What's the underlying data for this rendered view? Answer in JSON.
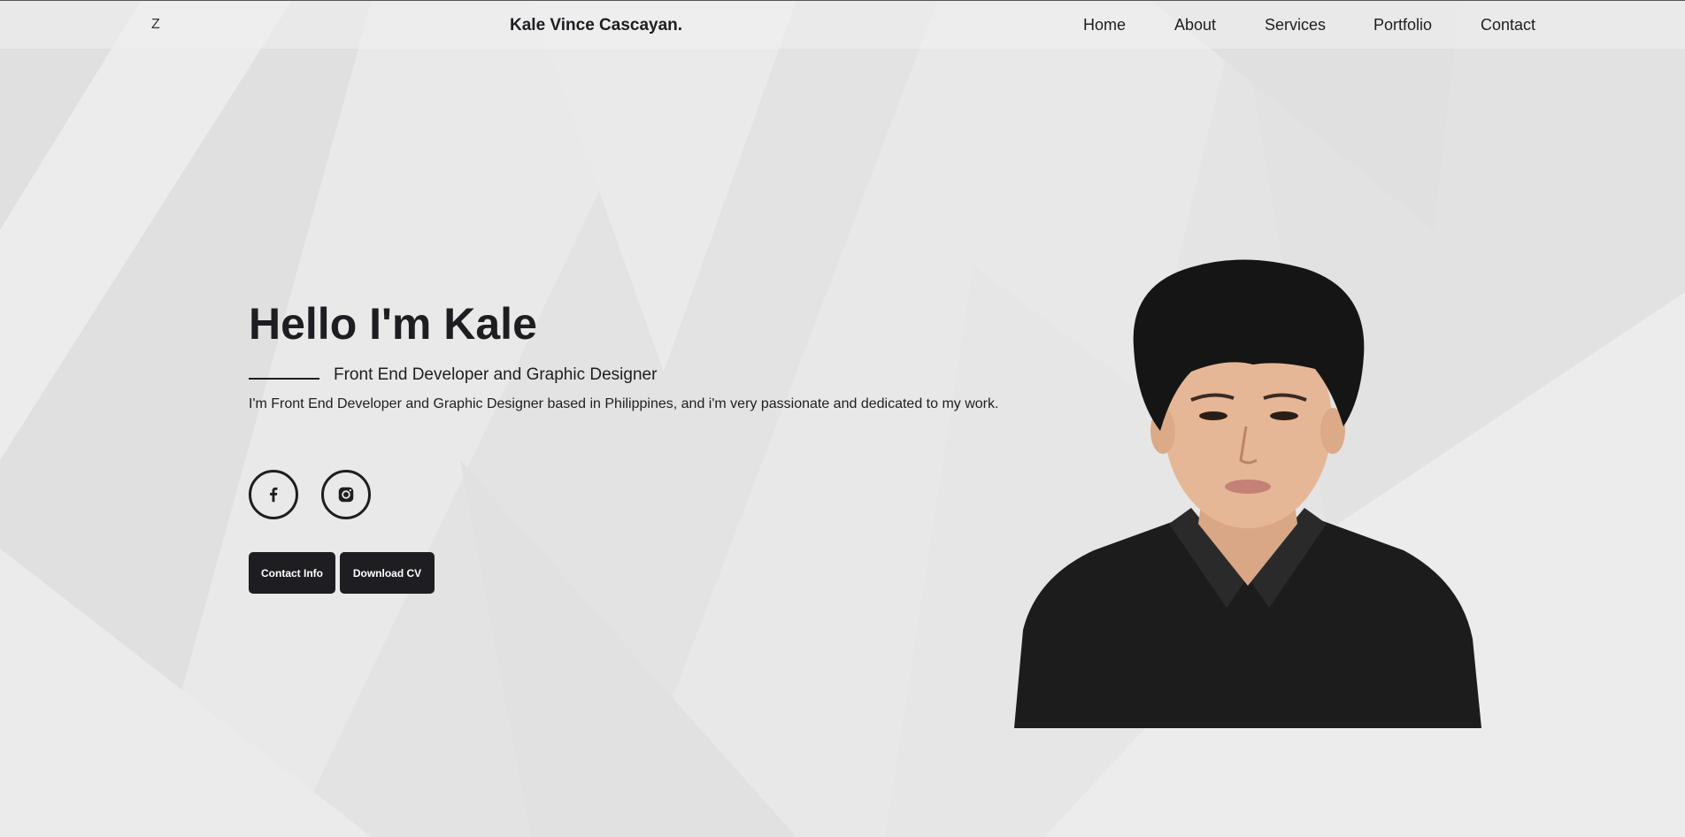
{
  "nav": {
    "toggle_label": "Z",
    "brand": "Kale Vince Cascayan.",
    "links": [
      "Home",
      "About",
      "Services",
      "Portfolio",
      "Contact"
    ]
  },
  "hero": {
    "heading": "Hello I'm Kale",
    "subtitle": "Front End Developer and Graphic Designer",
    "description": "I'm Front End Developer and Graphic Designer based in Philippines, and i'm very passionate and dedicated to my work.",
    "socials": [
      {
        "icon": "facebook-icon"
      },
      {
        "icon": "instagram-icon"
      }
    ],
    "buttons": {
      "contact_label": "Contact Info",
      "cv_label": "Download CV"
    }
  },
  "colors": {
    "accent": "#1e1e22",
    "background": "#e6e6e6",
    "button_text": "#ffffff"
  }
}
